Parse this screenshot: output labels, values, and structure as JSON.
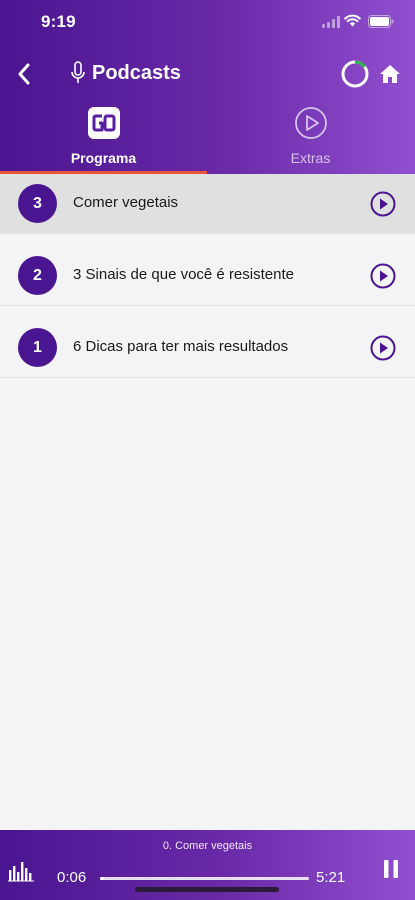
{
  "status_bar": {
    "time": "9:19"
  },
  "nav": {
    "title": "Podcasts",
    "progress": 0.15
  },
  "tabs": [
    {
      "label": "Programa",
      "active": true,
      "icon": "go-logo-icon"
    },
    {
      "label": "Extras",
      "active": false,
      "icon": "play-circle-icon"
    }
  ],
  "episodes": [
    {
      "number": "3",
      "title": "Comer vegetais",
      "selected": true
    },
    {
      "number": "2",
      "title": "3 Sinais de que você é resistente",
      "selected": false
    },
    {
      "number": "1",
      "title": "6 Dicas para ter mais resultados",
      "selected": false
    }
  ],
  "player": {
    "now_playing": "0. Comer vegetais",
    "elapsed": "0:06",
    "total": "5:21",
    "progress": 0.02
  },
  "colors": {
    "brand_purple": "#4a1590",
    "accent_orange": "#e8563a",
    "ring_green": "#2fb34a"
  }
}
